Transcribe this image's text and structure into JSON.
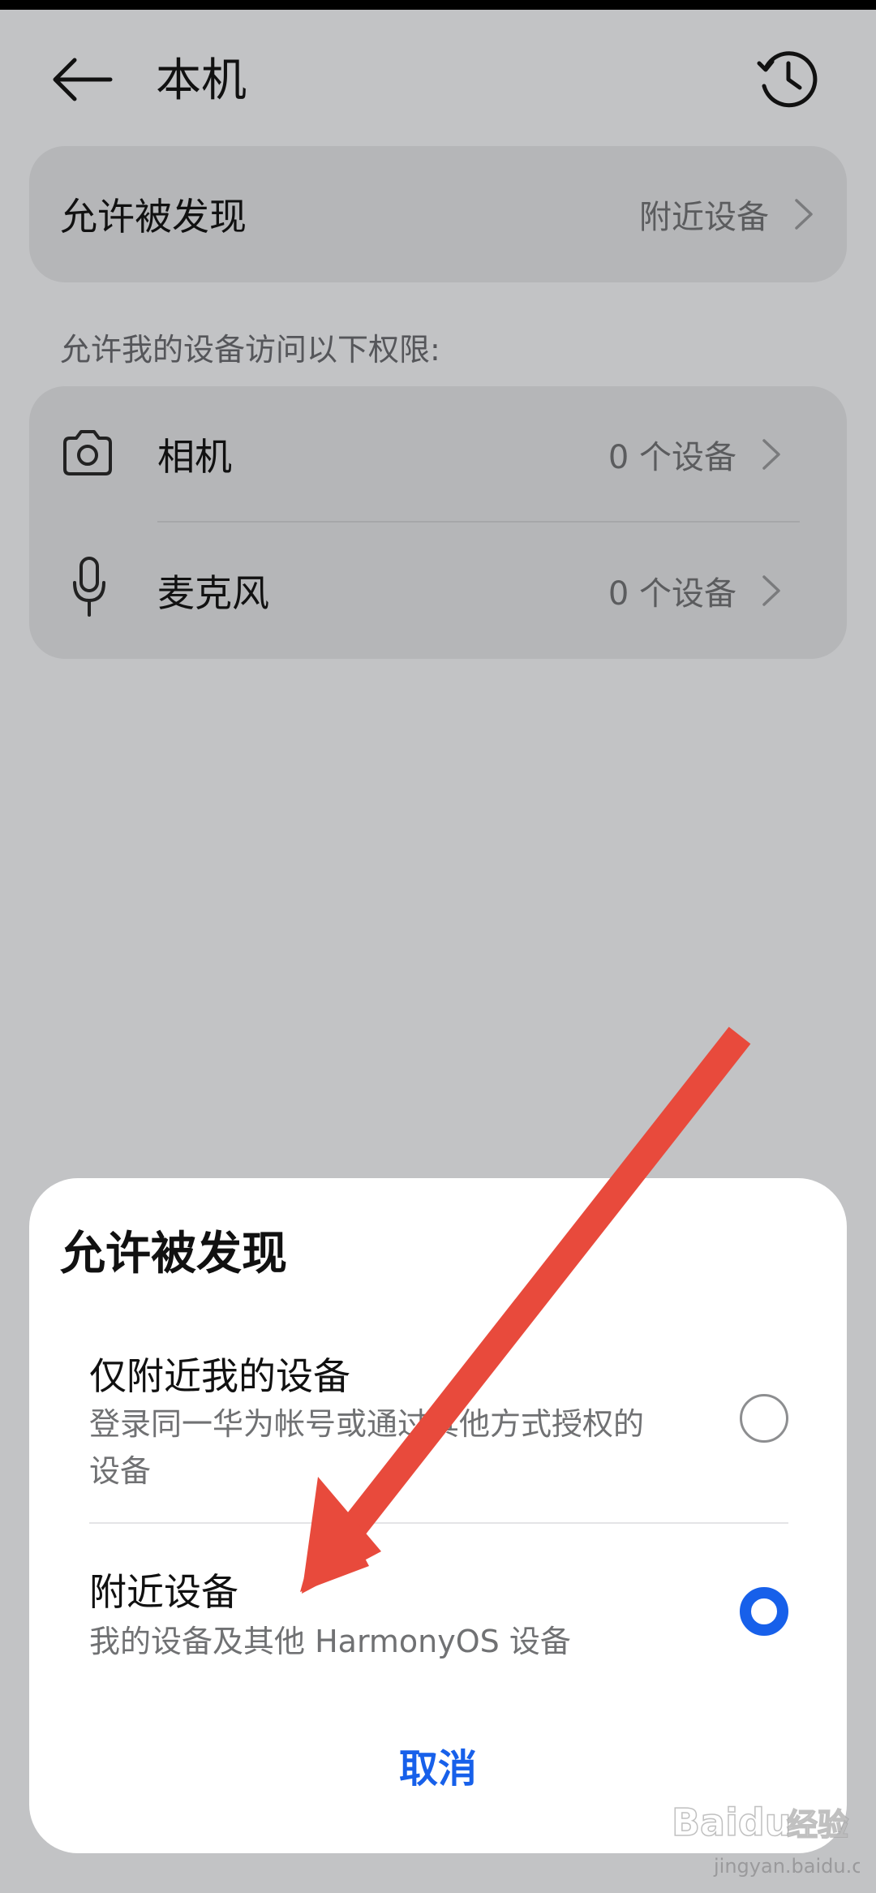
{
  "header": {
    "title": "本机",
    "back_icon": "arrow-left-icon",
    "history_icon": "history-clock-icon"
  },
  "discover_row": {
    "label": "允许被发现",
    "value": "附近设备"
  },
  "permissions": {
    "caption": "允许我的设备访问以下权限:",
    "items": [
      {
        "icon": "camera-icon",
        "label": "相机",
        "value": "0 个设备"
      },
      {
        "icon": "microphone-icon",
        "label": "麦克风",
        "value": "0 个设备"
      }
    ]
  },
  "dialog": {
    "title": "允许被发现",
    "options": [
      {
        "title": "仅附近我的设备",
        "description": "登录同一华为帐号或通过其他方式授权的设备",
        "selected": false
      },
      {
        "title": "附近设备",
        "description": "我的设备及其他 HarmonyOS 设备",
        "selected": true
      }
    ],
    "cancel_label": "取消"
  },
  "colors": {
    "accent": "#1760ea",
    "annotation_arrow": "#e84a3c",
    "background": "#c2c3c5",
    "card": "#b5b6b8"
  },
  "watermark": {
    "brand": "Baidu",
    "brand_cn": "经验",
    "site": "jingyan.baidu.com"
  }
}
